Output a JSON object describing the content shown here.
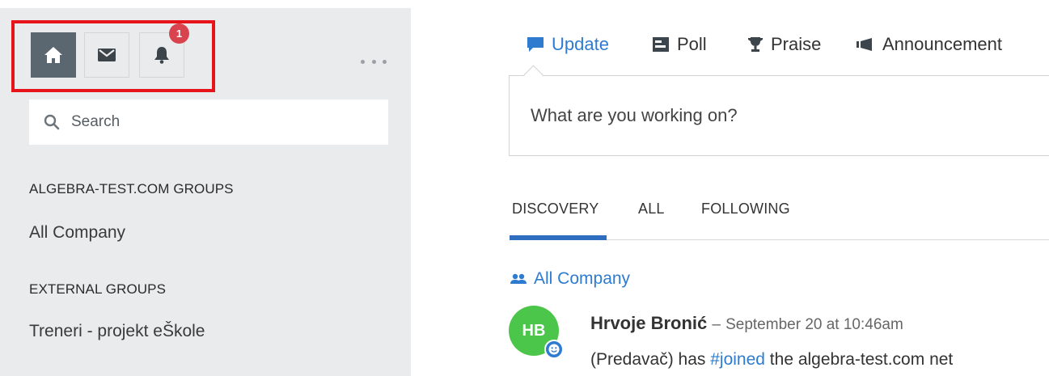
{
  "sidebar": {
    "nav": {
      "home_icon": "home-icon",
      "inbox_icon": "envelope-icon",
      "notifications_icon": "bell-icon",
      "notification_count": "1"
    },
    "more_icon": "ellipsis-icon",
    "search": {
      "placeholder": "Search",
      "icon": "search-icon"
    },
    "sections": [
      {
        "title": "ALGEBRA-TEST.COM GROUPS",
        "groups": [
          "All Company"
        ]
      },
      {
        "title": "EXTERNAL GROUPS",
        "groups": [
          "Treneri - projekt eŠkole"
        ]
      }
    ]
  },
  "publisher": {
    "tabs": [
      {
        "label": "Update",
        "icon": "speech-bubble-icon",
        "active": true
      },
      {
        "label": "Poll",
        "icon": "poll-icon",
        "active": false
      },
      {
        "label": "Praise",
        "icon": "trophy-icon",
        "active": false
      },
      {
        "label": "Announcement",
        "icon": "megaphone-icon",
        "active": false
      }
    ],
    "placeholder": "What are you working on?"
  },
  "feed": {
    "tabs": [
      {
        "label": "DISCOVERY",
        "active": true
      },
      {
        "label": "ALL",
        "active": false
      },
      {
        "label": "FOLLOWING",
        "active": false
      }
    ],
    "post": {
      "group": "All Company",
      "group_icon": "users-icon",
      "avatar_initials": "HB",
      "author": "Hrvoje Bronić",
      "separator": "–",
      "timestamp": "September 20 at 10:46am",
      "body_prefix": "(Predavač) has ",
      "hashtag": "#joined",
      "body_suffix": " the algebra-test.com net"
    }
  },
  "colors": {
    "accent": "#2e7bcf",
    "sidebar_bg": "#eaebec",
    "active_nav": "#5b6770",
    "badge": "#d9434e",
    "highlight": "#e8141b",
    "avatar": "#4cc64a"
  }
}
